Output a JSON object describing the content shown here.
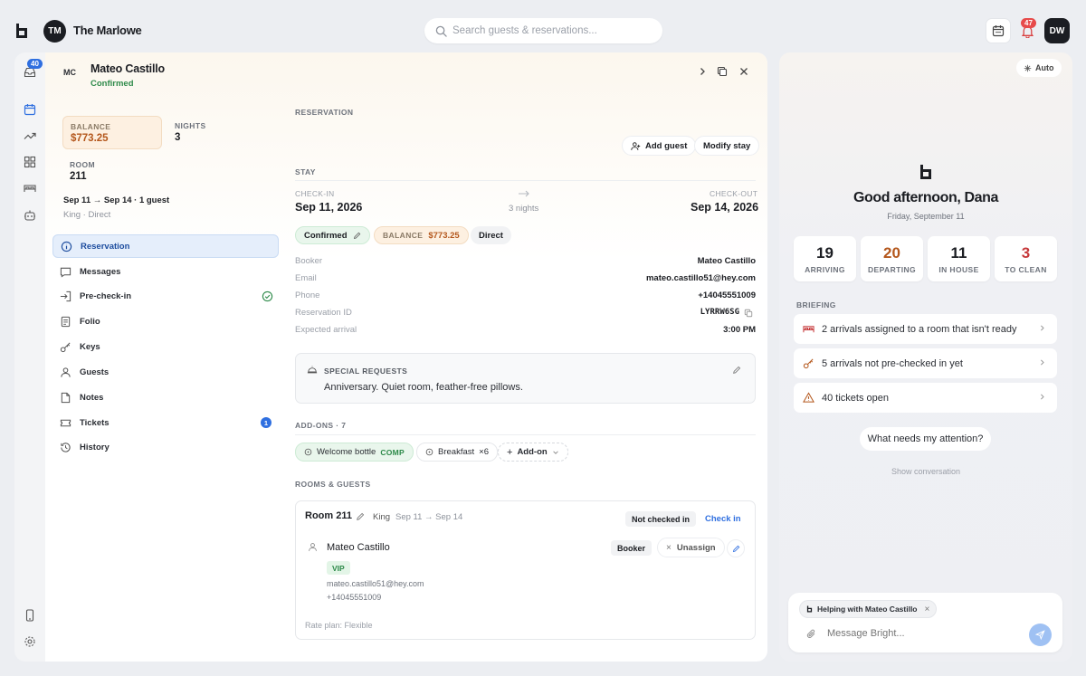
{
  "header": {
    "org_initials": "TM",
    "org_name": "The Marlowe",
    "search_placeholder": "Search guests & reservations...",
    "notifications_count": "47",
    "user_initials": "DW"
  },
  "rail": {
    "inbox_count": "40"
  },
  "guest": {
    "initials": "MC",
    "name": "Mateo Castillo",
    "status": "Confirmed",
    "balance_label": "BALANCE",
    "balance_value": "$773.25",
    "nights_label": "NIGHTS",
    "nights_value": "3",
    "room_label": "ROOM",
    "room_value": "211",
    "summary": "Sep 11 → Sep 14 · 1 guest",
    "sub_summary": "King · Direct"
  },
  "nav": [
    {
      "label": "Reservation",
      "icon": "info-icon"
    },
    {
      "label": "Messages",
      "icon": "message-icon"
    },
    {
      "label": "Pre-check-in",
      "icon": "login-icon"
    },
    {
      "label": "Folio",
      "icon": "document-icon"
    },
    {
      "label": "Keys",
      "icon": "key-icon"
    },
    {
      "label": "Guests",
      "icon": "user-icon"
    },
    {
      "label": "Notes",
      "icon": "note-icon"
    },
    {
      "label": "Tickets",
      "icon": "ticket-icon",
      "badge": "1"
    },
    {
      "label": "History",
      "icon": "history-icon"
    }
  ],
  "reservation": {
    "section_label": "RESERVATION",
    "add_guest": "Add guest",
    "modify_stay": "Modify stay",
    "stay_label": "STAY",
    "checkin_label": "CHECK-IN",
    "checkin_date": "Sep 11, 2026",
    "nights_text": "3 nights",
    "checkout_label": "CHECK-OUT",
    "checkout_date": "Sep 14, 2026",
    "status_pill": "Confirmed",
    "balance_pill_label": "BALANCE",
    "balance_pill_value": "$773.25",
    "channel_pill": "Direct",
    "details": [
      {
        "k": "Booker",
        "v": "Mateo Castillo"
      },
      {
        "k": "Email",
        "v": "mateo.castillo51@hey.com"
      },
      {
        "k": "Phone",
        "v": "+14045551009"
      },
      {
        "k": "Reservation ID",
        "v": "LYRRW6SG"
      },
      {
        "k": "Expected arrival",
        "v": "3:00 PM"
      }
    ],
    "special_label": "SPECIAL REQUESTS",
    "special_text": "Anniversary. Quiet room, feather-free pillows.",
    "addons_label": "ADD-ONS · 7",
    "addon_1": "Welcome bottle",
    "addon_1_tag": "COMP",
    "addon_2": "Breakfast",
    "addon_2_qty": "×6",
    "addon_add": "Add-on",
    "rooms_label": "ROOMS & GUESTS",
    "room_title": "Room 211",
    "room_type": "King",
    "room_dates": "Sep 11 → Sep 14",
    "room_status": "Not checked in",
    "check_in_btn": "Check in",
    "occupant_name": "Mateo Castillo",
    "occupant_role": "Booker",
    "unassign": "Unassign",
    "vip": "VIP",
    "occupant_email": "mateo.castillo51@hey.com",
    "occupant_phone": "+14045551009",
    "rate_plan": "Rate plan: Flexible"
  },
  "assistant": {
    "auto_label": "Auto",
    "greeting": "Good afternoon, Dana",
    "date": "Friday, September 11",
    "stats": [
      {
        "n": "19",
        "t": "ARRIVING"
      },
      {
        "n": "20",
        "t": "DEPARTING"
      },
      {
        "n": "11",
        "t": "IN HOUSE"
      },
      {
        "n": "3",
        "t": "TO CLEAN"
      }
    ],
    "briefing_label": "BRIEFING",
    "briefing": [
      "2 arrivals assigned to a room that isn't ready",
      "5 arrivals not pre-checked in yet",
      "40 tickets open"
    ],
    "suggestion": "What needs my attention?",
    "show_conversation": "Show conversation",
    "context_chip": "Helping with Mateo Castillo",
    "message_placeholder": "Message Bright..."
  },
  "colors": {
    "accent": "#2f6fe0",
    "confirmed": "#2e8a4a",
    "balance": "#b4571c",
    "danger": "#e74a4a"
  }
}
